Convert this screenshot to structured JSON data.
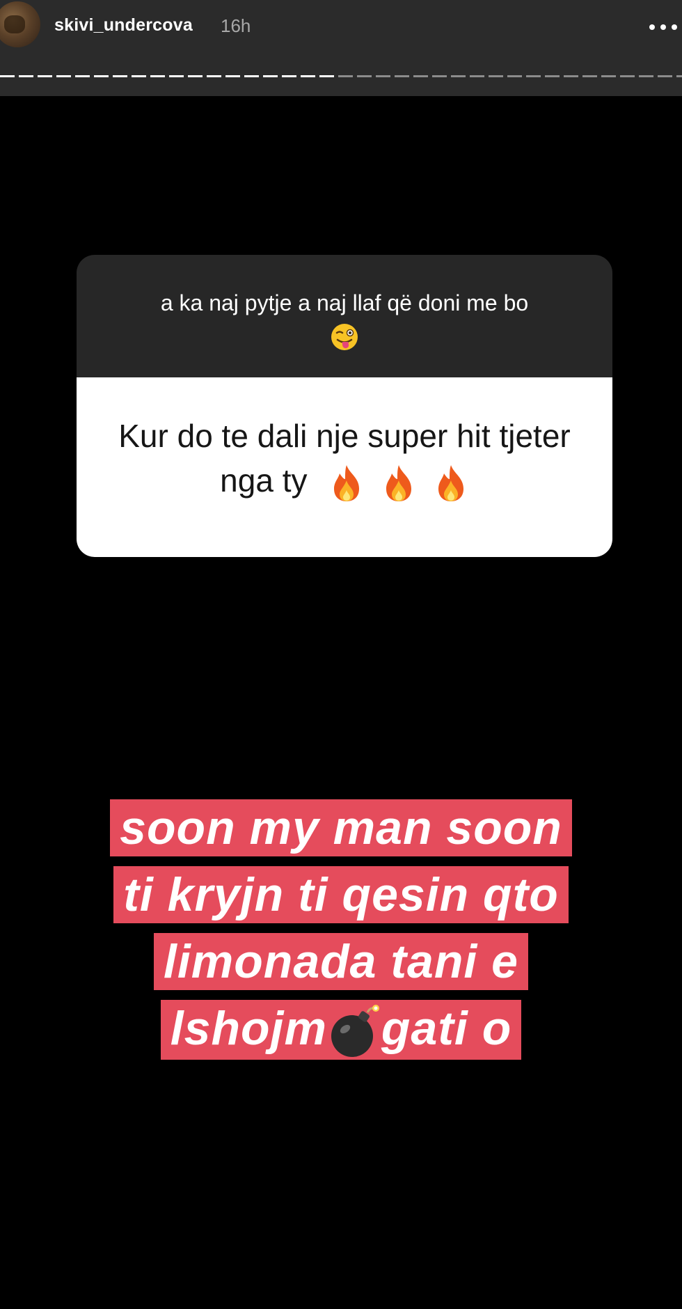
{
  "header": {
    "username": "skivi_undercova",
    "time_ago": "16h",
    "more_icon": "more-options-icon",
    "progress_fraction": 0.49
  },
  "sticker": {
    "prompt_text": "a ka naj pytje a naj llaf që doni me bo",
    "prompt_emoji": "winking-face-with-tongue",
    "answer_text": "Kur do te dali nje super hit tjeter nga ty",
    "answer_emojis": [
      "fire",
      "fire",
      "fire"
    ],
    "colors": {
      "top_background": "#272727",
      "bottom_background": "#ffffff"
    }
  },
  "reply": {
    "lines": [
      "soon my man soon",
      "ti kryjn ti qesin qto",
      "limonada tani e",
      "lshojm",
      "gati o"
    ],
    "line4_emoji": "bomb",
    "highlight_color": "#e54c5c"
  }
}
